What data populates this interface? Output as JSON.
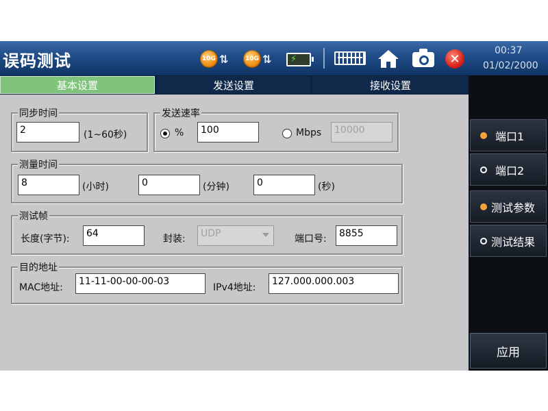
{
  "header": {
    "title": "误码测试",
    "port_badge_1": "10G",
    "port_badge_2": "10G",
    "time": "00:37",
    "date": "01/02/2000",
    "icons": [
      "port-10g-icon",
      "port-10g-icon",
      "battery-icon",
      "keyboard-icon",
      "home-icon",
      "camera-icon",
      "close-icon"
    ]
  },
  "tabs": [
    {
      "label": "基本设置",
      "active": true
    },
    {
      "label": "发送设置",
      "active": false
    },
    {
      "label": "接收设置",
      "active": false
    }
  ],
  "sidebar": {
    "items": [
      {
        "label": "端口1",
        "selected": true
      },
      {
        "label": "端口2",
        "selected": false
      },
      {
        "label": "测试参数",
        "selected": true
      },
      {
        "label": "测试结果",
        "selected": false
      }
    ],
    "apply_label": "应用"
  },
  "sync_time": {
    "legend": "同步时间",
    "value": "2",
    "range_hint": "(1~60秒)"
  },
  "send_rate": {
    "legend": "发送速率",
    "percent_label": "%",
    "percent_value": "100",
    "mbps_label": "Mbps",
    "mbps_value": "10000",
    "selected_mode": "%"
  },
  "measure_time": {
    "legend": "测量时间",
    "hours_value": "8",
    "hours_unit": "(小时)",
    "minutes_value": "0",
    "minutes_unit": "(分钟)",
    "seconds_value": "0",
    "seconds_unit": "(秒)"
  },
  "test_frame": {
    "legend": "测试帧",
    "length_label": "长度(字节):",
    "length_value": "64",
    "encap_label": "封装:",
    "encap_value": "UDP",
    "port_label": "端口号:",
    "port_value": "8855"
  },
  "destination": {
    "legend": "目的地址",
    "mac_label": "MAC地址:",
    "mac_value": "11-11-00-00-00-03",
    "ipv4_label": "IPv4地址:",
    "ipv4_value": "127.000.000.003"
  },
  "colors": {
    "header_blue": "#1f4b86",
    "tab_active_green": "#7fc37c",
    "content_gray": "#c8c8ca",
    "selected_dot_orange": "#f6a23a"
  }
}
